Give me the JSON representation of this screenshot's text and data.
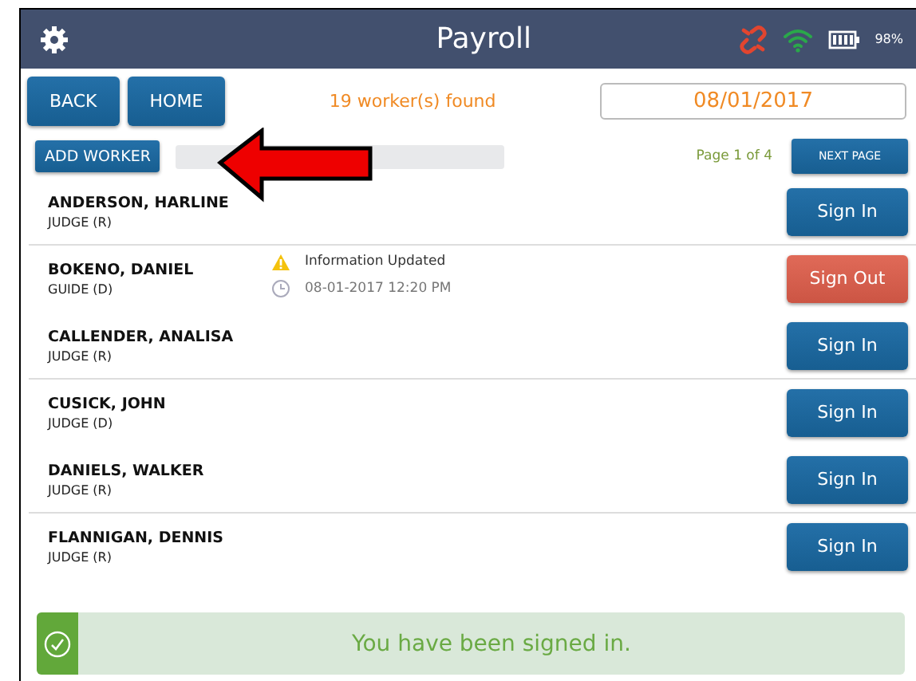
{
  "header": {
    "title": "Payroll",
    "battery": "98%"
  },
  "toolbar": {
    "buttons": [
      "BACK",
      "HOME"
    ],
    "found": "19 worker(s) found",
    "date": "08/01/2017",
    "add_button": "ADD WORKER",
    "page": "Page 1 of 4",
    "next_button": "NEXT PAGE"
  },
  "workers": [
    {
      "name": "ANDERSON, HARLINE",
      "role": "JUDGE (R)",
      "action": {
        "kind": "sign_in",
        "label": "Sign In"
      },
      "divider_below": true
    },
    {
      "name": "BOKENO, DANIEL",
      "role": "GUIDE (D)",
      "notice": "Information Updated",
      "timestamp": "08-01-2017 12:20 PM",
      "action": {
        "kind": "sign_out",
        "label": "Sign Out"
      },
      "divider_below": false
    },
    {
      "name": "CALLENDER, ANALISA",
      "role": "JUDGE (R)",
      "action": {
        "kind": "sign_in",
        "label": "Sign In"
      },
      "divider_below": true
    },
    {
      "name": "CUSICK, JOHN",
      "role": "JUDGE (D)",
      "action": {
        "kind": "sign_in",
        "label": "Sign In"
      },
      "divider_below": false
    },
    {
      "name": "DANIELS, WALKER",
      "role": "JUDGE (R)",
      "action": {
        "kind": "sign_in",
        "label": "Sign In"
      },
      "divider_below": true
    },
    {
      "name": "FLANNIGAN, DENNIS",
      "role": "JUDGE (R)",
      "action": {
        "kind": "sign_in",
        "label": "Sign In"
      },
      "divider_below": false
    }
  ],
  "banner": {
    "message": "You have been signed in."
  }
}
